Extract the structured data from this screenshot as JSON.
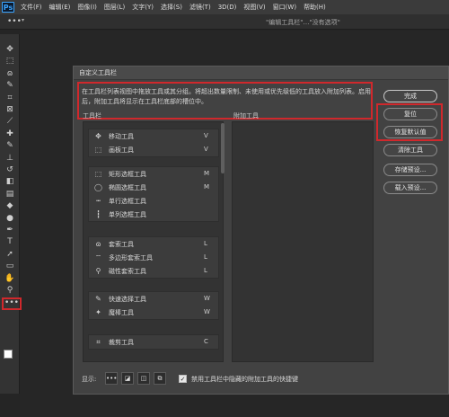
{
  "app": {
    "logo": "Ps"
  },
  "menubar": [
    "文件(F)",
    "编辑(E)",
    "图像(I)",
    "图层(L)",
    "文字(Y)",
    "选择(S)",
    "滤镜(T)",
    "3D(D)",
    "视图(V)",
    "窗口(W)",
    "帮助(H)"
  ],
  "optbar": {
    "more_label": "•••",
    "hint": "\"编辑工具栏\"…\"没有选项\""
  },
  "dialog": {
    "title": "自定义工具栏",
    "description": "在工具栏列表视图中拖放工具或其分组。将超出数量限制、未使用或优先级低的工具放入附加列表。启用后，附加工具将显示在工具栏底部的槽位中。",
    "toolbar_label": "工具栏",
    "extra_label": "附加工具",
    "groups": [
      {
        "tools": [
          {
            "icon": "move-icon",
            "glyph": "✥",
            "name": "移动工具",
            "key": "V"
          },
          {
            "icon": "artboard-icon",
            "glyph": "⬚",
            "name": "画板工具",
            "key": "V"
          }
        ]
      },
      {
        "tools": [
          {
            "icon": "rect-marquee-icon",
            "glyph": "⬚",
            "name": "矩形选框工具",
            "key": "M"
          },
          {
            "icon": "ellipse-marquee-icon",
            "glyph": "◯",
            "name": "椭圆选框工具",
            "key": "M"
          },
          {
            "icon": "row-marquee-icon",
            "glyph": "┅",
            "name": "单行选框工具",
            "key": ""
          },
          {
            "icon": "column-marquee-icon",
            "glyph": "┇",
            "name": "单列选框工具",
            "key": ""
          }
        ]
      },
      {
        "tools": [
          {
            "icon": "lasso-icon",
            "glyph": "ɷ",
            "name": "套索工具",
            "key": "L"
          },
          {
            "icon": "polygonal-lasso-icon",
            "glyph": "⌔",
            "name": "多边形套索工具",
            "key": "L"
          },
          {
            "icon": "magnetic-lasso-icon",
            "glyph": "⚲",
            "name": "磁性套索工具",
            "key": "L"
          }
        ]
      },
      {
        "tools": [
          {
            "icon": "quick-select-icon",
            "glyph": "✎",
            "name": "快速选择工具",
            "key": "W"
          },
          {
            "icon": "magic-wand-icon",
            "glyph": "✦",
            "name": "魔棒工具",
            "key": "W"
          }
        ]
      },
      {
        "tools": [
          {
            "icon": "crop-icon",
            "glyph": "⌗",
            "name": "裁剪工具",
            "key": "C"
          }
        ]
      }
    ],
    "buttons": {
      "done": "完成",
      "reset": "复位",
      "restore_defaults": "恢复默认值",
      "clear_tools": "清除工具",
      "save_preset": "存储预设...",
      "load_preset": "载入预设..."
    },
    "footer": {
      "show_label": "显示:",
      "check_mark": "✓",
      "checkbox_label": "禁用工具栏中隐藏的附加工具的快捷键",
      "icons": [
        {
          "name": "more-icon",
          "glyph": "•••"
        },
        {
          "name": "swap-colors-icon",
          "glyph": "◪"
        },
        {
          "name": "quick-mask-icon",
          "glyph": "◫"
        },
        {
          "name": "screen-mode-icon",
          "glyph": "⧉"
        }
      ]
    }
  },
  "tools_panel": [
    {
      "name": "move-tool-icon",
      "glyph": "✥"
    },
    {
      "name": "marquee-tool-icon",
      "glyph": "⬚"
    },
    {
      "name": "lasso-tool-icon",
      "glyph": "ɷ"
    },
    {
      "name": "quick-select-tool-icon",
      "glyph": "✎"
    },
    {
      "name": "crop-tool-icon",
      "glyph": "⌗"
    },
    {
      "name": "frame-tool-icon",
      "glyph": "⊠"
    },
    {
      "name": "eyedropper-tool-icon",
      "glyph": "⟋"
    },
    {
      "name": "healing-tool-icon",
      "glyph": "✚"
    },
    {
      "name": "brush-tool-icon",
      "glyph": "✎"
    },
    {
      "name": "stamp-tool-icon",
      "glyph": "⊥"
    },
    {
      "name": "history-brush-icon",
      "glyph": "↺"
    },
    {
      "name": "eraser-tool-icon",
      "glyph": "◧"
    },
    {
      "name": "gradient-tool-icon",
      "glyph": "▤"
    },
    {
      "name": "blur-tool-icon",
      "glyph": "◆"
    },
    {
      "name": "dodge-tool-icon",
      "glyph": "●"
    },
    {
      "name": "pen-tool-icon",
      "glyph": "✒"
    },
    {
      "name": "type-tool-icon",
      "glyph": "T"
    },
    {
      "name": "path-select-tool-icon",
      "glyph": "➚"
    },
    {
      "name": "rectangle-tool-icon",
      "glyph": "▭"
    },
    {
      "name": "hand-tool-icon",
      "glyph": "✋"
    },
    {
      "name": "zoom-tool-icon",
      "glyph": "⚲"
    }
  ]
}
